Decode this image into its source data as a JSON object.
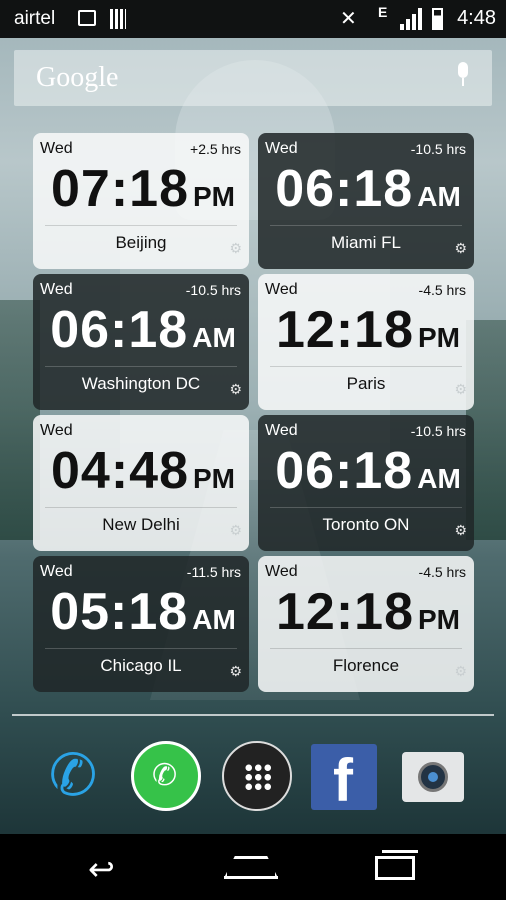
{
  "status_bar": {
    "carrier": "airtel",
    "network_type": "E",
    "time": "4:48",
    "icons": [
      "notification-icon",
      "sim-icon",
      "mute-icon",
      "signal-icon",
      "battery-charging-icon"
    ]
  },
  "search": {
    "logo": "Google",
    "icon": "mic-icon"
  },
  "widgets": [
    {
      "day": "Wed",
      "offset": "+2.5 hrs",
      "time": "07:18",
      "ampm": "PM",
      "city": "Beijing",
      "theme": "light"
    },
    {
      "day": "Wed",
      "offset": "-10.5 hrs",
      "time": "06:18",
      "ampm": "AM",
      "city": "Miami FL",
      "theme": "dark"
    },
    {
      "day": "Wed",
      "offset": "-10.5 hrs",
      "time": "06:18",
      "ampm": "AM",
      "city": "Washington DC",
      "theme": "dark"
    },
    {
      "day": "Wed",
      "offset": "-4.5 hrs",
      "time": "12:18",
      "ampm": "PM",
      "city": "Paris",
      "theme": "light"
    },
    {
      "day": "Wed",
      "offset": "",
      "time": "04:48",
      "ampm": "PM",
      "city": "New Delhi",
      "theme": "light"
    },
    {
      "day": "Wed",
      "offset": "-10.5 hrs",
      "time": "06:18",
      "ampm": "AM",
      "city": "Toronto ON",
      "theme": "dark"
    },
    {
      "day": "Wed",
      "offset": "-11.5 hrs",
      "time": "05:18",
      "ampm": "AM",
      "city": "Chicago IL",
      "theme": "dark"
    },
    {
      "day": "Wed",
      "offset": "-4.5 hrs",
      "time": "12:18",
      "ampm": "PM",
      "city": "Florence",
      "theme": "light"
    }
  ],
  "dock": {
    "apps": [
      "phone-icon",
      "whatsapp-icon",
      "app-launcher-icon",
      "facebook-icon",
      "camera-icon"
    ],
    "facebook_glyph": "f"
  },
  "navigation": [
    "back-icon",
    "home-icon",
    "recent-apps-icon"
  ],
  "colors": {
    "phone_blue": "#2aa3e6",
    "whatsapp_green": "#36c249",
    "facebook_blue": "#3b5ea8"
  }
}
